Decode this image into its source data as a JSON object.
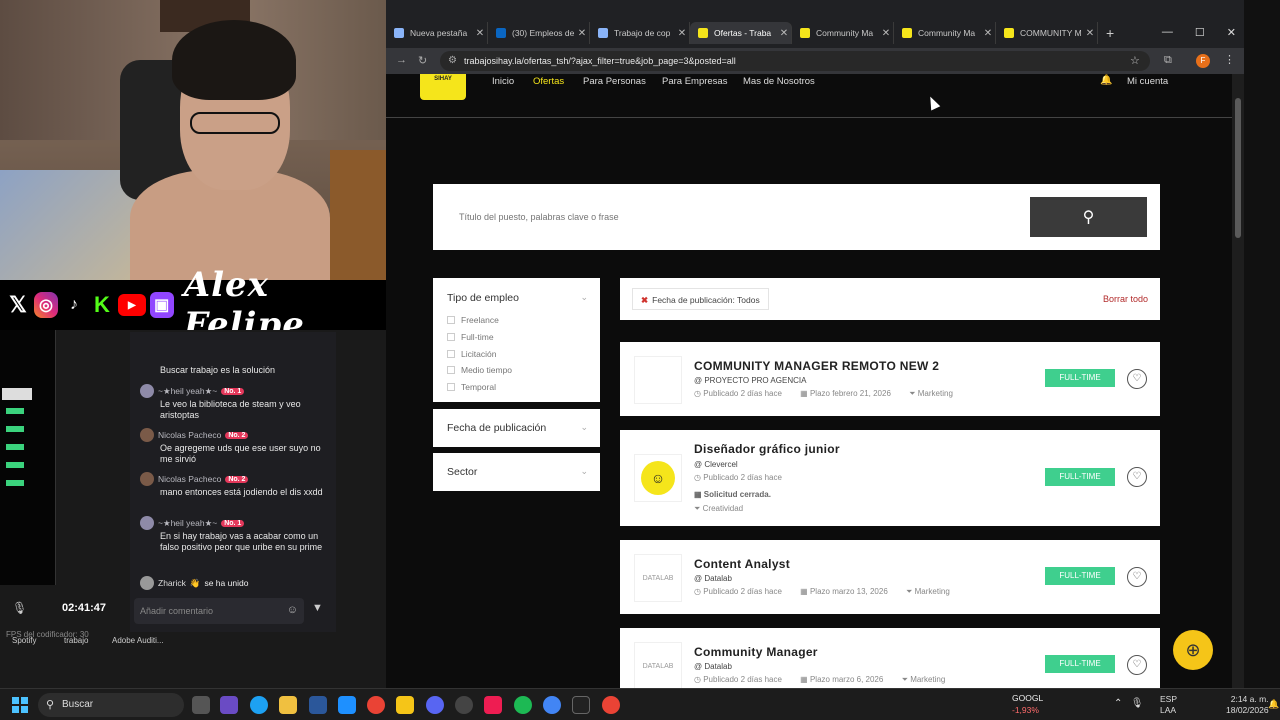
{
  "social": {
    "brand": "Alex Felipe",
    "icons": [
      "x-icon",
      "instagram-icon",
      "tiktok-icon",
      "kick-icon",
      "youtube-icon",
      "twitch-icon"
    ]
  },
  "chat": {
    "messages": [
      {
        "name": "",
        "badge": "",
        "text": "Buscar trabajo es la solución"
      },
      {
        "name": "~★heil yeah★~",
        "badge": "No. 1",
        "text": "Le veo la biblioteca de steam y veo aristoptas"
      },
      {
        "name": "Nicolas Pacheco",
        "badge": "No. 2",
        "text": "Oe agregeme uds que ese user suyo no me sirvió"
      },
      {
        "name": "Nicolas Pacheco",
        "badge": "No. 2",
        "text": "mano entonces está jodiendo el dis xxdd"
      },
      {
        "name": "~★heil yeah★~",
        "badge": "No. 1",
        "text": "En si hay trabajo vas a acabar como un falso positivo peor que uribe en su prime"
      }
    ],
    "join": {
      "name": "Zharick",
      "text": "se ha unido"
    },
    "timer": "02:41:47",
    "comment_placeholder": "Añadir comentario"
  },
  "obs": {
    "fps_label": "FPS del codificador:",
    "fps_value": "30",
    "desktop_icons": [
      "Spotify",
      "trabajo",
      "Adobe Auditi..."
    ]
  },
  "browser": {
    "tabs": [
      {
        "title": "Nueva pestaña",
        "color": "#8ab4f8",
        "active": false
      },
      {
        "title": "(30) Empleos de",
        "color": "#0a66c2",
        "active": false
      },
      {
        "title": "Trabajo de cop",
        "color": "#8ab4f8",
        "active": false
      },
      {
        "title": "Ofertas - Traba",
        "color": "#f5e51b",
        "active": true
      },
      {
        "title": "Community Ma",
        "color": "#f5e51b",
        "active": false
      },
      {
        "title": "Community Ma",
        "color": "#f5e51b",
        "active": false
      },
      {
        "title": "COMMUNITY M",
        "color": "#f5e51b",
        "active": false
      }
    ],
    "url": "trabajosihay.la/ofertas_tsh/?ajax_filter=true&job_page=3&posted=all",
    "profile_initial": "F"
  },
  "site": {
    "logo_text": "SIHAY",
    "nav": [
      "Inicio",
      "Ofertas",
      "Para Personas",
      "Para Empresas",
      "Mas de Nosotros"
    ],
    "active_nav": "Ofertas",
    "account": "Mi cuenta",
    "search_placeholder": "Título del puesto, palabras clave o frase"
  },
  "filters": {
    "employment_type": {
      "title": "Tipo de empleo",
      "options": [
        "Freelance",
        "Full-time",
        "Licitación",
        "Medio tiempo",
        "Temporal"
      ]
    },
    "published_title": "Fecha de publicación",
    "sector_title": "Sector",
    "active_chip": "Fecha de publicación: Todos",
    "clear_all": "Borrar todo"
  },
  "jobs": [
    {
      "title": "COMMUNITY MANAGER REMOTO NEW 2",
      "company": "@ PROYECTO PRO AGENCIA",
      "posted": "Publicado 2 días hace",
      "deadline": "Plazo febrero 21, 2026",
      "category": "Marketing",
      "type": "FULL-TIME",
      "logo": ""
    },
    {
      "title": "Diseñador gráfico junior",
      "company": "@ Clevercel",
      "posted": "Publicado 2 días hace",
      "status": "Solicitud cerrada.",
      "category": "Creatividad",
      "type": "FULL-TIME",
      "logo": ""
    },
    {
      "title": "Content Analyst",
      "company": "@ Datalab",
      "posted": "Publicado 2 días hace",
      "deadline": "Plazo marzo 13, 2026",
      "category": "Marketing",
      "type": "FULL-TIME",
      "logo": "DATALAB"
    },
    {
      "title": "Community Manager",
      "company": "@ Datalab",
      "posted": "Publicado 2 días hace",
      "deadline": "Plazo marzo 6, 2026",
      "category": "Marketing",
      "type": "FULL-TIME",
      "logo": "DATALAB"
    }
  ],
  "taskbar": {
    "search": "Buscar",
    "stock_name": "GOOGL",
    "stock_change": "-1,93%",
    "lang": "ESP",
    "lang2": "LAA",
    "time": "2:14 a. m.",
    "date": "18/02/2026"
  }
}
